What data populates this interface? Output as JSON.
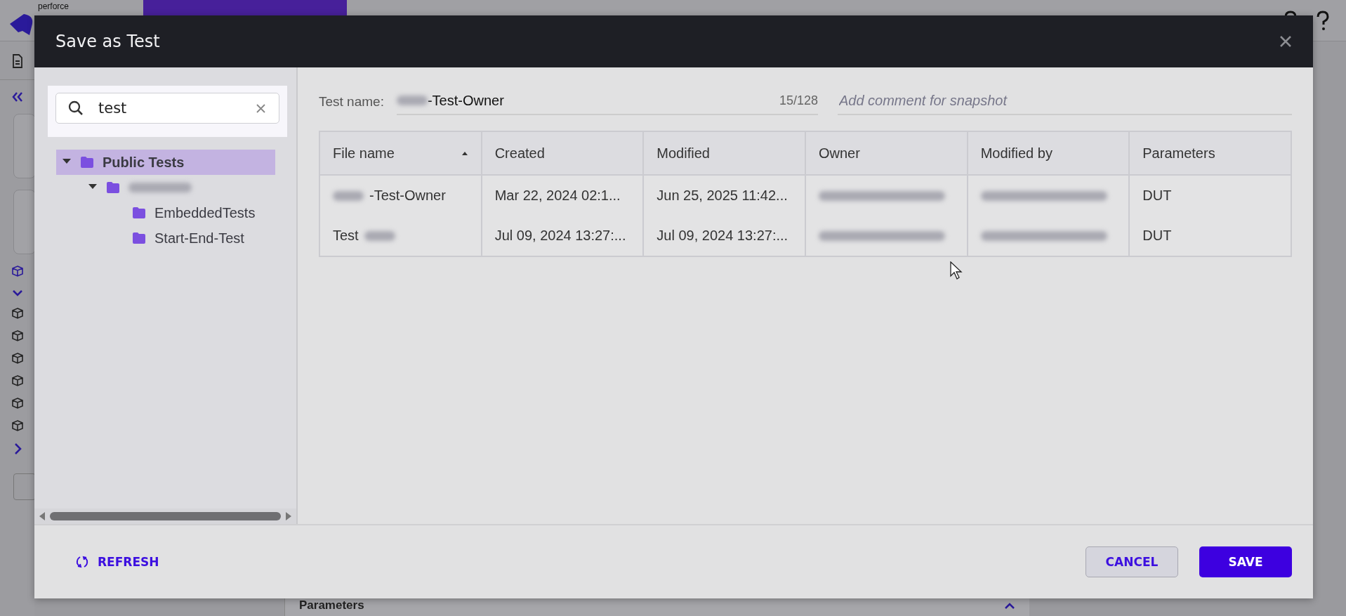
{
  "app": {
    "brand": "perforce",
    "bottom_panel": {
      "title": "Parameters"
    }
  },
  "dialog": {
    "title": "Save as Test",
    "search": {
      "value": "test"
    },
    "tree": [
      {
        "label": "Public Tests",
        "blurred": false,
        "selected": true,
        "expanded": true,
        "children": [
          {
            "blurred": true,
            "selected": false,
            "expanded": true,
            "children": [
              {
                "label": "EmbeddedTests",
                "blurred": false,
                "selected": false
              },
              {
                "label": "Start-End-Test",
                "blurred": false,
                "selected": false
              }
            ]
          }
        ]
      }
    ],
    "test_name": {
      "label": "Test name:",
      "parts": [
        {
          "kind": "blur"
        },
        {
          "kind": "text",
          "text": "-Test-Owner"
        }
      ],
      "counter": "15/128"
    },
    "comment": {
      "placeholder": "Add comment for snapshot"
    },
    "table": {
      "columns": [
        {
          "label": "File name",
          "sorted": true
        },
        {
          "label": "Created",
          "sorted": false
        },
        {
          "label": "Modified",
          "sorted": false
        },
        {
          "label": "Owner",
          "sorted": false
        },
        {
          "label": "Modified by",
          "sorted": false
        },
        {
          "label": "Parameters",
          "sorted": false
        }
      ],
      "rows": [
        {
          "cells": [
            [
              {
                "kind": "blur"
              },
              {
                "kind": "text",
                "text": "-Test-Owner"
              }
            ],
            [
              {
                "kind": "text",
                "text": "Mar 22, 2024 02:1..."
              }
            ],
            [
              {
                "kind": "text",
                "text": "Jun 25, 2025 11:42..."
              }
            ],
            [
              {
                "kind": "blur"
              }
            ],
            [
              {
                "kind": "blur"
              }
            ],
            [
              {
                "kind": "text",
                "text": "DUT"
              }
            ]
          ]
        },
        {
          "cells": [
            [
              {
                "kind": "text",
                "text": "Test"
              },
              {
                "kind": "blur"
              }
            ],
            [
              {
                "kind": "text",
                "text": "Jul 09, 2024 13:27:..."
              }
            ],
            [
              {
                "kind": "text",
                "text": "Jul 09, 2024 13:27:..."
              }
            ],
            [
              {
                "kind": "blur"
              }
            ],
            [
              {
                "kind": "blur"
              }
            ],
            [
              {
                "kind": "text",
                "text": "DUT"
              }
            ]
          ]
        }
      ]
    },
    "buttons": [
      {
        "label": "REFRESH",
        "kind": "link"
      },
      {
        "label": "CANCEL",
        "kind": "secondary"
      },
      {
        "label": "SAVE",
        "kind": "primary"
      }
    ]
  }
}
